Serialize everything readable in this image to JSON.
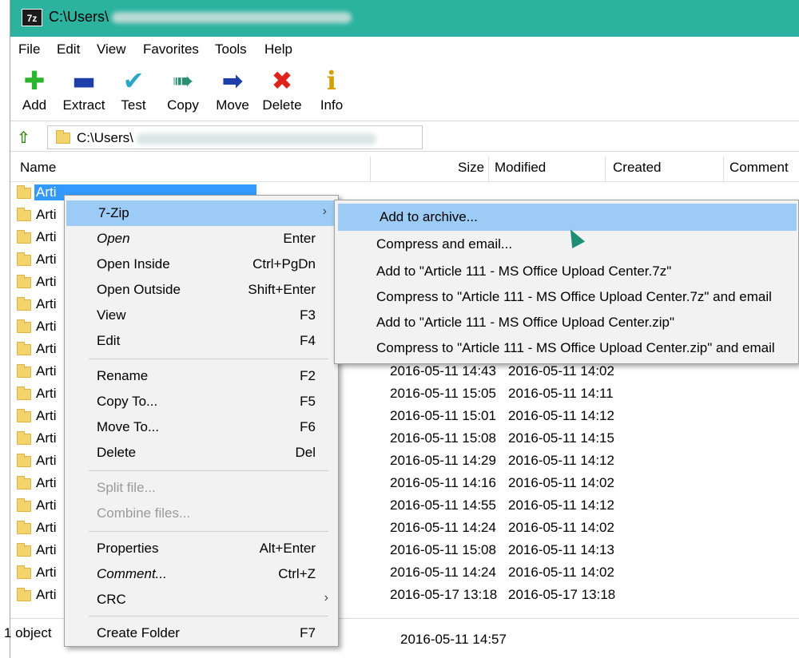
{
  "window": {
    "title_path": "C:\\Users\\",
    "app_icon": "7z"
  },
  "menubar": [
    "File",
    "Edit",
    "View",
    "Favorites",
    "Tools",
    "Help"
  ],
  "toolbar": [
    {
      "label": "Add",
      "icon": "plus-icon",
      "color": "#2cb52c"
    },
    {
      "label": "Extract",
      "icon": "minus-icon",
      "color": "#1f3fa8"
    },
    {
      "label": "Test",
      "icon": "check-icon",
      "color": "#27a8c9"
    },
    {
      "label": "Copy",
      "icon": "double-arrow-icon",
      "color": "#2a8f6f"
    },
    {
      "label": "Move",
      "icon": "arrow-right-icon",
      "color": "#1f3fa8"
    },
    {
      "label": "Delete",
      "icon": "x-icon",
      "color": "#e0231a"
    },
    {
      "label": "Info",
      "icon": "info-icon",
      "color": "#d4a000"
    }
  ],
  "address": {
    "path": "C:\\Users\\"
  },
  "columns": {
    "name": "Name",
    "size": "Size",
    "modified": "Modified",
    "created": "Created",
    "comment": "Comment"
  },
  "list": {
    "row_name": "Arti",
    "rows": [
      {
        "modified": "",
        "created": ""
      },
      {
        "modified": "",
        "created": ""
      },
      {
        "modified": "",
        "created": ""
      },
      {
        "modified": "",
        "created": ""
      },
      {
        "modified": "",
        "created": ""
      },
      {
        "modified": "",
        "created": ""
      },
      {
        "modified": "",
        "created": ""
      },
      {
        "modified": "",
        "created": ""
      },
      {
        "modified": "2016-05-11 14:43",
        "created": "2016-05-11 14:02"
      },
      {
        "modified": "2016-05-11 15:05",
        "created": "2016-05-11 14:11"
      },
      {
        "modified": "2016-05-11 15:01",
        "created": "2016-05-11 14:12"
      },
      {
        "modified": "2016-05-11 15:08",
        "created": "2016-05-11 14:15"
      },
      {
        "modified": "2016-05-11 14:29",
        "created": "2016-05-11 14:12"
      },
      {
        "modified": "2016-05-11 14:16",
        "created": "2016-05-11 14:02"
      },
      {
        "modified": "2016-05-11 14:55",
        "created": "2016-05-11 14:12"
      },
      {
        "modified": "2016-05-11 14:24",
        "created": "2016-05-11 14:02"
      },
      {
        "modified": "2016-05-11 15:08",
        "created": "2016-05-11 14:13"
      },
      {
        "modified": "2016-05-11 14:24",
        "created": "2016-05-11 14:02"
      },
      {
        "modified": "2016-05-17 13:18",
        "created": "2016-05-17 13:18"
      }
    ]
  },
  "status": {
    "objects": "1 object",
    "time": "2016-05-11 14:57"
  },
  "context_menu": {
    "items": [
      {
        "label": "7-Zip",
        "key": "",
        "submenu": true
      },
      {
        "label": "Open",
        "key": "Enter"
      },
      {
        "label": "Open Inside",
        "key": "Ctrl+PgDn"
      },
      {
        "label": "Open Outside",
        "key": "Shift+Enter"
      },
      {
        "label": "View",
        "key": "F3"
      },
      {
        "label": "Edit",
        "key": "F4"
      },
      {
        "label": "Rename",
        "key": "F2"
      },
      {
        "label": "Copy To...",
        "key": "F5"
      },
      {
        "label": "Move To...",
        "key": "F6"
      },
      {
        "label": "Delete",
        "key": "Del"
      },
      {
        "label": "Split file...",
        "key": ""
      },
      {
        "label": "Combine files...",
        "key": ""
      },
      {
        "label": "Properties",
        "key": "Alt+Enter"
      },
      {
        "label": "Comment...",
        "key": "Ctrl+Z"
      },
      {
        "label": "CRC",
        "key": "",
        "submenu": true
      },
      {
        "label": "Create Folder",
        "key": "F7"
      }
    ]
  },
  "submenu": {
    "items": [
      "Add to archive...",
      "Compress and email...",
      "Add to \"Article 111 - MS Office Upload Center.7z\"",
      "Compress to \"Article 111 - MS Office Upload Center.7z\" and email",
      "Add to \"Article 111 - MS Office Upload Center.zip\"",
      "Compress to \"Article 111 - MS Office Upload Center.zip\" and email"
    ]
  }
}
